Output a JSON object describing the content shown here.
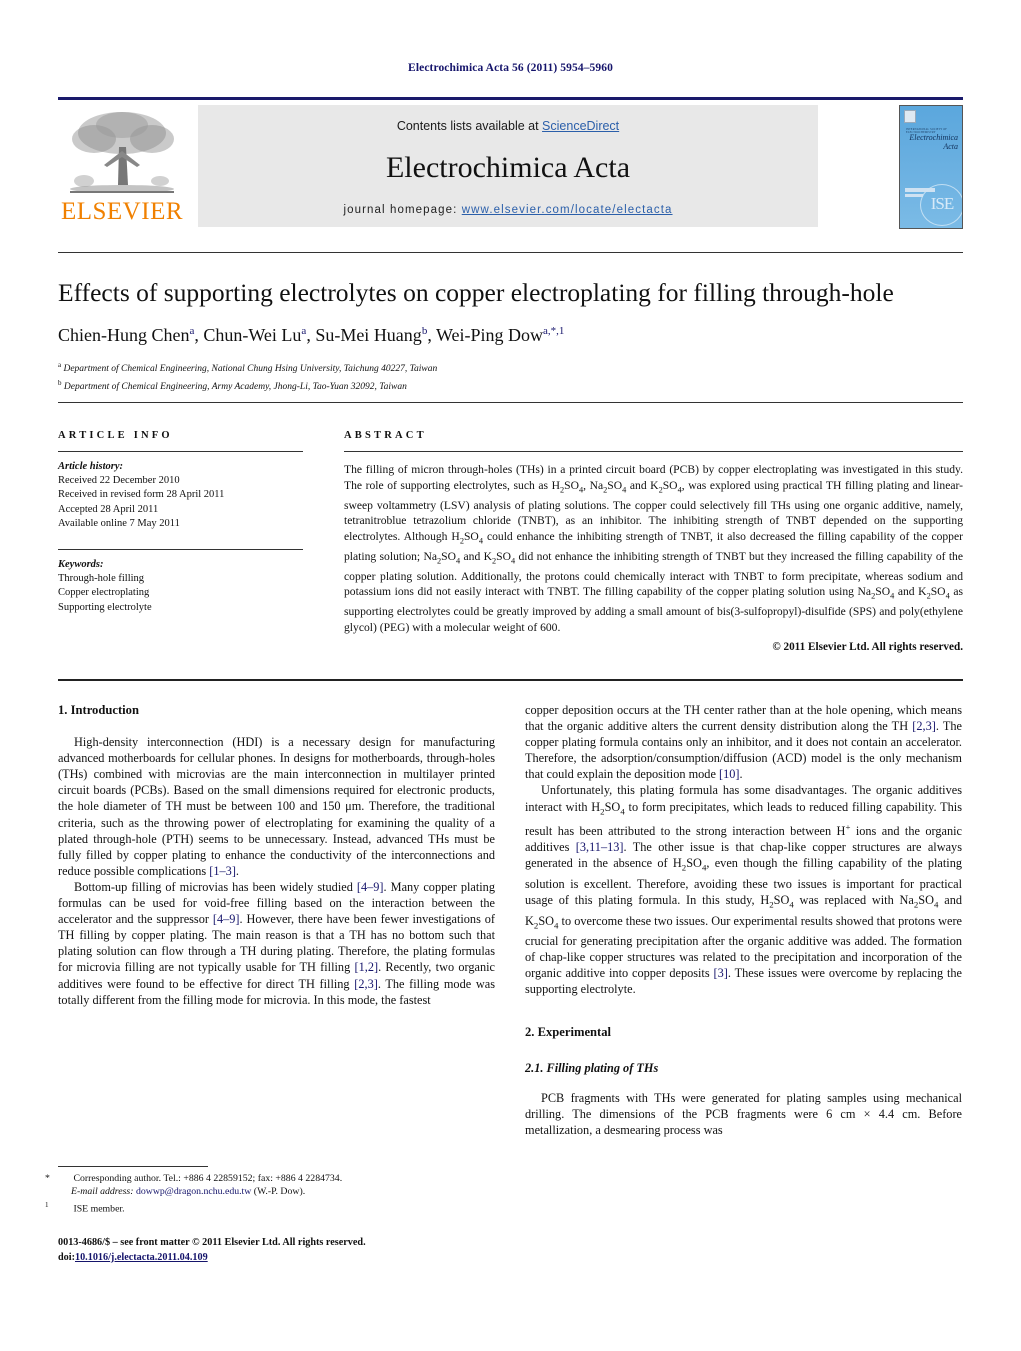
{
  "running_head": "Electrochimica Acta 56 (2011) 5954–5960",
  "masthead": {
    "contents_prefix": "Contents lists available at ",
    "contents_link": "ScienceDirect",
    "journal_title": "Electrochimica Acta",
    "homepage_prefix": "journal homepage: ",
    "homepage_url": "www.elsevier.com/locate/electacta",
    "publisher_name": "ELSEVIER",
    "publisher_color": "#f08000",
    "cover": {
      "society_line": "INTERNATIONAL SOCIETY OF ELECTROCHEMISTRY",
      "title_line1": "Electrochimica",
      "title_line2": "Acta",
      "badge": "ISE",
      "background_color": "#67aee0"
    }
  },
  "title": "Effects of supporting electrolytes on copper electroplating for filling through-hole",
  "authors_html": "Chien-Hung Chen<sup>a</sup>, Chun-Wei Lu<sup>a</sup>, Su-Mei Huang<sup>b</sup>, Wei-Ping Dow<sup>a,*,1</sup>",
  "affiliations": [
    "Department of Chemical Engineering, National Chung Hsing University, Taichung 40227, Taiwan",
    "Department of Chemical Engineering, Army Academy, Jhong-Li, Tao-Yuan 32092, Taiwan"
  ],
  "affiliation_marks": [
    "a",
    "b"
  ],
  "article_info": {
    "heading": "ARTICLE INFO",
    "history_label": "Article history:",
    "history": [
      "Received 22 December 2010",
      "Received in revised form 28 April 2011",
      "Accepted 28 April 2011",
      "Available online 7 May 2011"
    ],
    "keywords_label": "Keywords:",
    "keywords": [
      "Through-hole filling",
      "Copper electroplating",
      "Supporting electrolyte"
    ]
  },
  "abstract": {
    "heading": "ABSTRACT",
    "text_html": "The filling of micron through-holes (THs) in a printed circuit board (PCB) by copper electroplating was investigated in this study. The role of supporting electrolytes, such as H<sub>2</sub>SO<sub>4</sub>, Na<sub>2</sub>SO<sub>4</sub> and K<sub>2</sub>SO<sub>4</sub>, was explored using practical TH filling plating and linear-sweep voltammetry (LSV) analysis of plating solutions. The copper could selectively fill THs using one organic additive, namely, tetranitroblue tetrazolium chloride (TNBT), as an inhibitor. The inhibiting strength of TNBT depended on the supporting electrolytes. Although H<sub>2</sub>SO<sub>4</sub> could enhance the inhibiting strength of TNBT, it also decreased the filling capability of the copper plating solution; Na<sub>2</sub>SO<sub>4</sub> and K<sub>2</sub>SO<sub>4</sub> did not enhance the inhibiting strength of TNBT but they increased the filling capability of the copper plating solution. Additionally, the protons could chemically interact with TNBT to form precipitate, whereas sodium and potassium ions did not easily interact with TNBT. The filling capability of the copper plating solution using Na<sub>2</sub>SO<sub>4</sub> and K<sub>2</sub>SO<sub>4</sub> as supporting electrolytes could be greatly improved by adding a small amount of bis(3-sulfopropyl)-disulfide (SPS) and poly(ethylene glycol) (PEG) with a molecular weight of 600.",
    "copyright": "© 2011 Elsevier Ltd. All rights reserved."
  },
  "body": {
    "left": {
      "h1_introduction": "1.  Introduction",
      "p1_html": "High-density interconnection (HDI) is a necessary design for manufacturing advanced motherboards for cellular phones. In designs for motherboards, through-holes (THs) combined with microvias are the main interconnection in multilayer printed circuit boards (PCBs). Based on the small dimensions required for electronic products, the hole diameter of TH must be between 100 and 150 μm. Therefore, the traditional criteria, such as the throwing power of electroplating for examining the quality of a plated through-hole (PTH) seems to be unnecessary. Instead, advanced THs must be fully filled by copper plating to enhance the conductivity of the interconnections and reduce possible complications <span class=\"ref\">[1–3]</span>.",
      "p2_html": "Bottom-up filling of microvias has been widely studied <span class=\"ref\">[4–9]</span>. Many copper plating formulas can be used for void-free filling based on the interaction between the accelerator and the suppressor <span class=\"ref\">[4–9]</span>. However, there have been fewer investigations of TH filling by copper plating. The main reason is that a TH has no bottom such that plating solution can flow through a TH during plating. Therefore, the plating formulas for microvia filling are not typically usable for TH filling <span class=\"ref\">[1,2]</span>. Recently, two organic additives were found to be effective for direct TH filling <span class=\"ref\">[2,3]</span>. The filling mode was totally different from the filling mode for microvia. In this mode, the fastest"
    },
    "right": {
      "p1_html": "copper deposition occurs at the TH center rather than at the hole opening, which means that the organic additive alters the current density distribution along the TH <span class=\"ref\">[2,3]</span>. The copper plating formula contains only an inhibitor, and it does not contain an accelerator. Therefore, the adsorption/consumption/diffusion (ACD) model is the only mechanism that could explain the deposition mode <span class=\"ref\">[10]</span>.",
      "p2_html": "Unfortunately, this plating formula has some disadvantages. The organic additives interact with H<sub>2</sub>SO<sub>4</sub> to form precipitates, which leads to reduced filling capability. This result has been attributed to the strong interaction between H<sup>+</sup> ions and the organic additives <span class=\"ref\">[3,11–13]</span>. The other issue is that chap-like copper structures are always generated in the absence of H<sub>2</sub>SO<sub>4</sub>, even though the filling capability of the plating solution is excellent. Therefore, avoiding these two issues is important for practical usage of this plating formula. In this study, H<sub>2</sub>SO<sub>4</sub> was replaced with Na<sub>2</sub>SO<sub>4</sub> and K<sub>2</sub>SO<sub>4</sub> to overcome these two issues. Our experimental results showed that protons were crucial for generating precipitation after the organic additive was added. The formation of chap-like copper structures was related to the precipitation and incorporation of the organic additive into copper deposits <span class=\"ref\">[3]</span>. These issues were overcome by replacing the supporting electrolyte.",
      "h1_experimental": "2.  Experimental",
      "h2_filling": "2.1.  Filling plating of THs",
      "p3_html": "PCB fragments with THs were generated for plating samples using mechanical drilling. The dimensions of the PCB fragments were 6 cm × 4.4 cm. Before metallization, a desmearing process was"
    }
  },
  "footnotes": {
    "corresponding_html": "<span class=\"mark\">*</span> Corresponding author. Tel.: +886 4 22859152; fax: +886 4 2284734.",
    "email_html": "<em>E-mail address:</em> <span class=\"lnk\">dowwp@dragon.nchu.edu.tw</span> (W.-P. Dow).",
    "ise_html": "<span class=\"mark\"><sup>1</sup></span> ISE member."
  },
  "imprint": {
    "line1": "0013-4686/$ – see front matter © 2011 Elsevier Ltd. All rights reserved.",
    "doi_label": "doi:",
    "doi_value": "10.1016/j.electacta.2011.04.109"
  }
}
